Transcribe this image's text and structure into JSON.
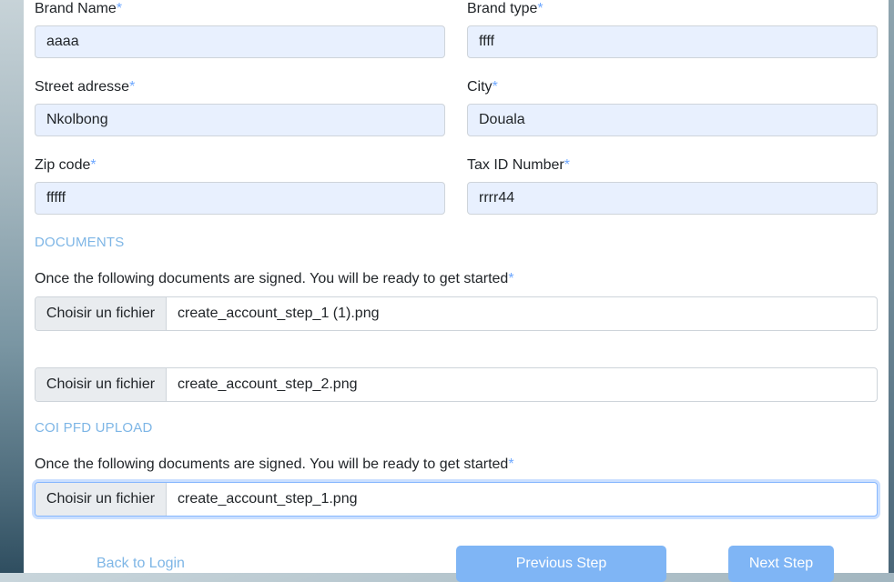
{
  "form": {
    "brand_name": {
      "label": "Brand Name",
      "value": "aaaa"
    },
    "brand_type": {
      "label": "Brand type",
      "value": "ffff"
    },
    "street": {
      "label": "Street adresse",
      "value": "Nkolbong"
    },
    "city": {
      "label": "City",
      "value": "Douala"
    },
    "zip": {
      "label": "Zip code",
      "value": "fffff"
    },
    "tax_id": {
      "label": "Tax ID Number",
      "value": "rrrr44"
    },
    "required_mark": "*"
  },
  "documents": {
    "heading": "DOCUMENTS",
    "description": "Once the following documents are signed. You will be ready to get started",
    "files": [
      {
        "button": "Choisir un fichier",
        "filename": "create_account_step_1 (1).png"
      },
      {
        "button": "Choisir un fichier",
        "filename": "create_account_step_2.png"
      }
    ]
  },
  "coi": {
    "heading": "COI PFD UPLOAD",
    "description": "Once the following documents are signed. You will be ready to get started",
    "file": {
      "button": "Choisir un fichier",
      "filename": "create_account_step_1.png"
    }
  },
  "actions": {
    "back_login": "Back to Login",
    "previous": "Previous Step",
    "next": "Next Step"
  },
  "colors": {
    "accent": "#7eb6e6",
    "button": "#7fb5f5",
    "field_bg": "#e8f0fe"
  }
}
